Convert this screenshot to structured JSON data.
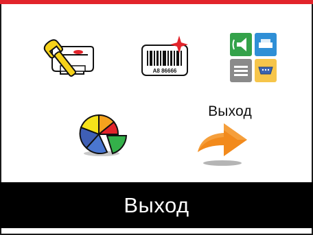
{
  "menu": {
    "items": [
      {
        "id": "settings",
        "icon": "settings-wrench-icon"
      },
      {
        "id": "barcode",
        "icon": "barcode-icon",
        "barcode_text": "A8 86666"
      },
      {
        "id": "interfaces",
        "icon": "interfaces-icon"
      },
      {
        "id": "statistics",
        "icon": "pie-chart-icon"
      },
      {
        "id": "exit",
        "icon": "exit-arrow-icon",
        "label": "Выход"
      }
    ],
    "selected": "exit"
  },
  "footer": {
    "title": "Выход"
  },
  "colors": {
    "top_bar": "#e2242b",
    "footer_bg": "#000000",
    "footer_text": "#ffffff",
    "exit_arrow": "#f28a1c"
  }
}
